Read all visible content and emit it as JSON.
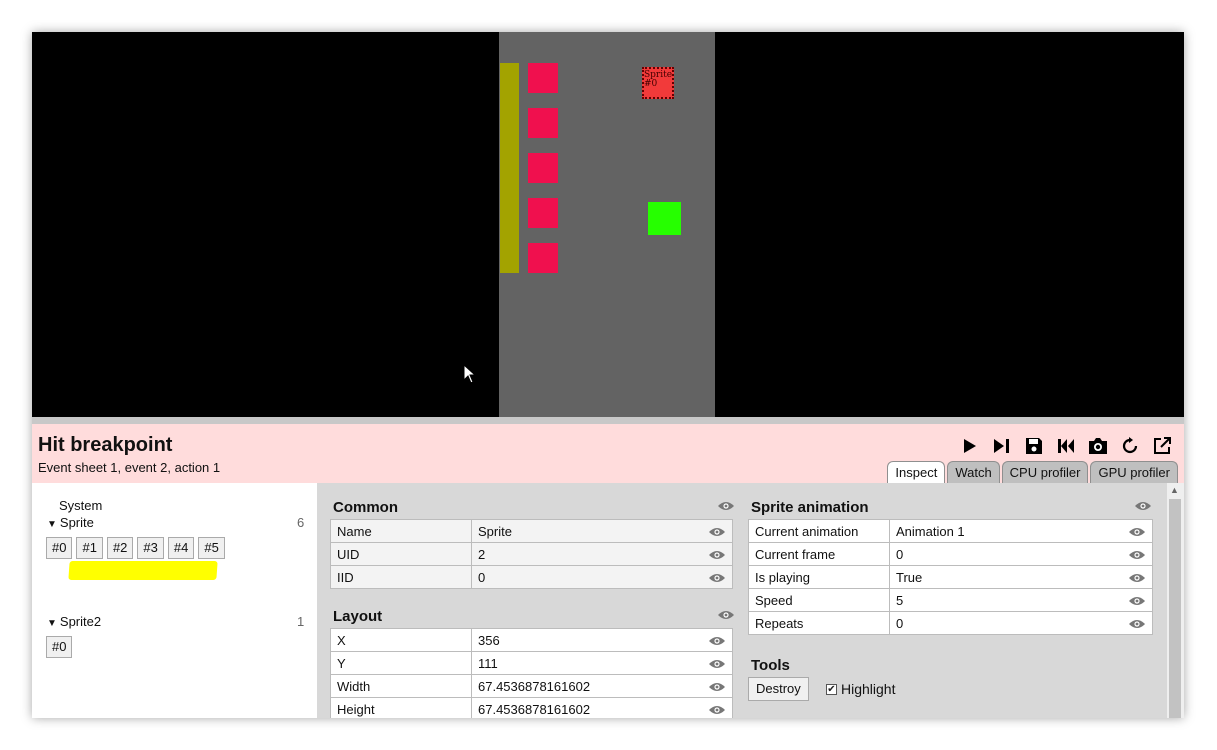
{
  "game": {
    "selected_sprite_label": "Sprite",
    "selected_sprite_label2": "#0"
  },
  "debugger": {
    "title": "Hit breakpoint",
    "subtitle": "Event sheet 1, event 2, action 1",
    "toolbar": [
      "play-icon",
      "step-icon",
      "save-icon",
      "restart-icon",
      "screenshot-icon",
      "reload-icon",
      "popout-icon"
    ],
    "tabs": [
      {
        "label": "Inspect",
        "active": true
      },
      {
        "label": "Watch",
        "active": false
      },
      {
        "label": "CPU profiler",
        "active": false
      },
      {
        "label": "GPU profiler",
        "active": false
      }
    ]
  },
  "tree": {
    "system": "System",
    "sprite": {
      "name": "Sprite",
      "count": "6",
      "instances": [
        "#0",
        "#1",
        "#2",
        "#3",
        "#4",
        "#5"
      ]
    },
    "sprite2": {
      "name": "Sprite2",
      "count": "1",
      "instances": [
        "#0"
      ]
    }
  },
  "inspector": {
    "common": {
      "title": "Common",
      "rows": [
        {
          "key": "Name",
          "value": "Sprite"
        },
        {
          "key": "UID",
          "value": "2"
        },
        {
          "key": "IID",
          "value": "0"
        }
      ]
    },
    "layout": {
      "title": "Layout",
      "rows": [
        {
          "key": "X",
          "value": "356"
        },
        {
          "key": "Y",
          "value": "111"
        },
        {
          "key": "Width",
          "value": "67.4536878161602"
        },
        {
          "key": "Height",
          "value": "67.4536878161602"
        }
      ]
    },
    "animation": {
      "title": "Sprite animation",
      "rows": [
        {
          "key": "Current animation",
          "value": "Animation 1"
        },
        {
          "key": "Current frame",
          "value": "0"
        },
        {
          "key": "Is playing",
          "value": "True"
        },
        {
          "key": "Speed",
          "value": "5"
        },
        {
          "key": "Repeats",
          "value": "0"
        }
      ]
    },
    "tools": {
      "title": "Tools",
      "destroy_label": "Destroy",
      "highlight_label": "Highlight",
      "highlight_checked": true
    }
  }
}
